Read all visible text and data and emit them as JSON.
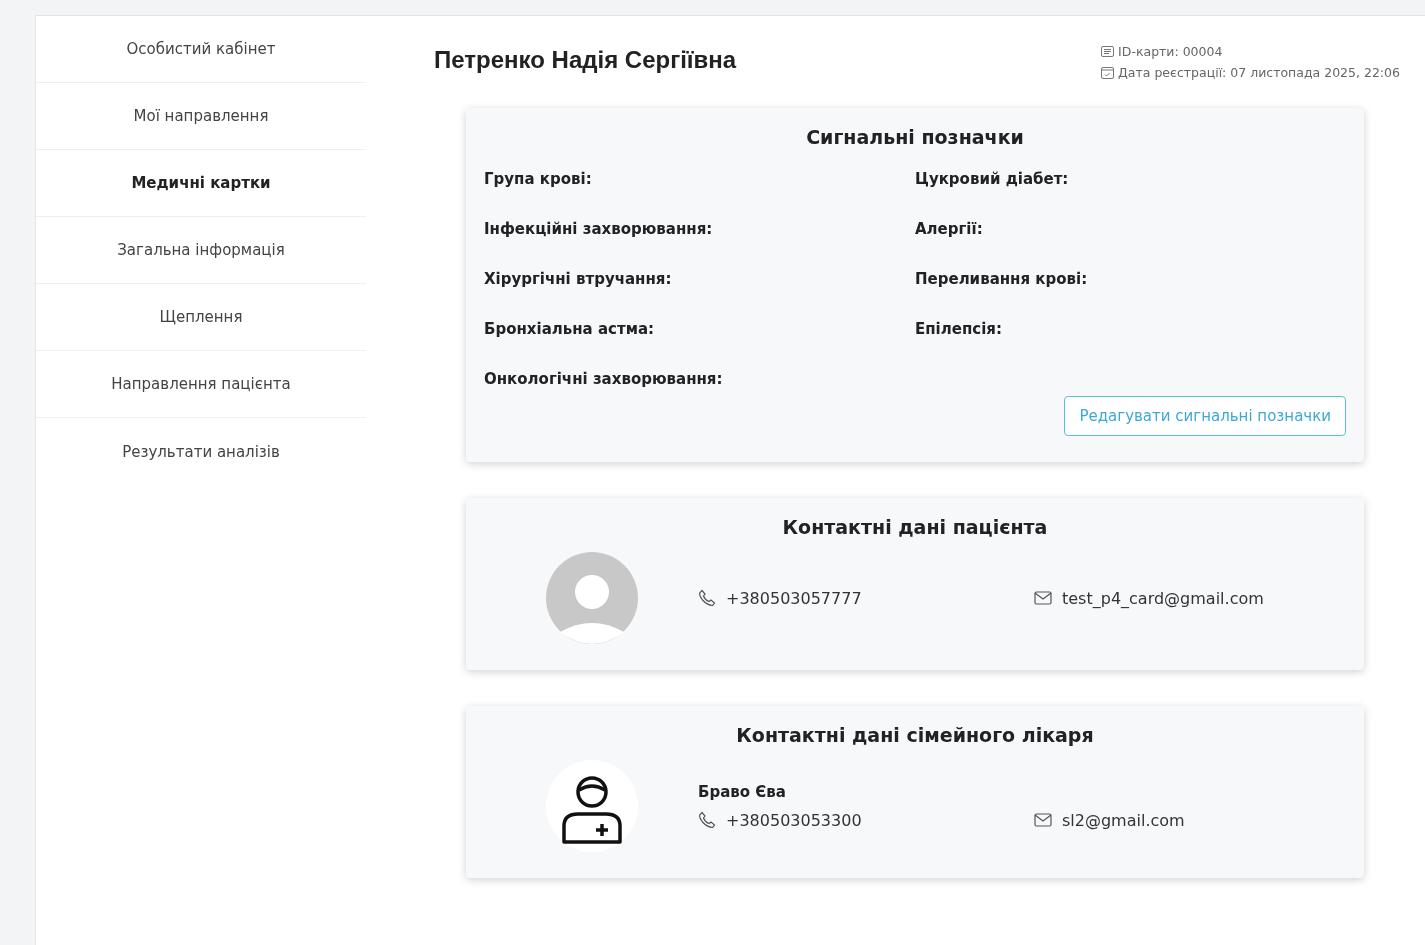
{
  "sidebar": {
    "items": [
      {
        "label": "Особистий кабінет",
        "selected": false
      },
      {
        "label": "Мої направлення",
        "selected": false
      },
      {
        "label": "Медичні картки",
        "selected": true
      },
      {
        "label": "Загальна інформація",
        "selected": false
      },
      {
        "label": "Щеплення",
        "selected": false
      },
      {
        "label": "Направлення пацієнта",
        "selected": false
      },
      {
        "label": "Результати аналізів",
        "selected": false
      }
    ]
  },
  "header": {
    "patient_name": "Петренко Надія Сергіївна",
    "card_id": "ID-карти: 00004",
    "registration_date": "Дата реєстрації: 07 листопада 2025, 22:06"
  },
  "signal_flags": {
    "title": "Сигнальні позначки",
    "fields": [
      "Група крові:",
      "Цукровий діабет:",
      "Інфекційні захворювання:",
      "Алергії:",
      "Хірургічні втручання:",
      "Переливання крові:",
      "Бронхіальна астма:",
      "Епілепсія:",
      "Онкологічні захворювання:"
    ],
    "edit_button": "Редагувати сигнальні позначки"
  },
  "patient_contacts": {
    "title": "Контактні дані пацієнта",
    "phone": "+380503057777",
    "email": "test_p4_card@gmail.com"
  },
  "doctor_contacts": {
    "title": "Контактні дані сімейного лікаря",
    "name": "Браво Єва",
    "phone": "+380503053300",
    "email": "sl2@gmail.com"
  }
}
